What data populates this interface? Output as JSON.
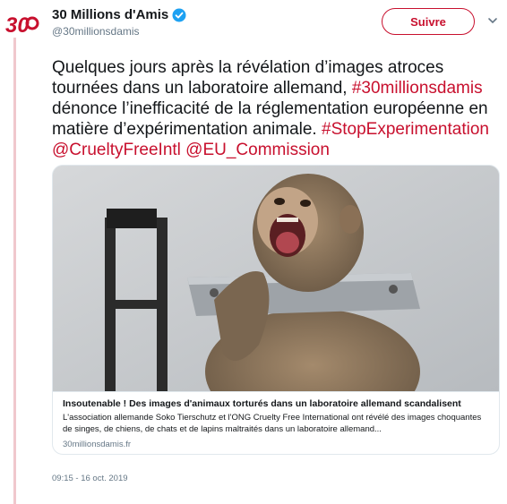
{
  "account": {
    "name": "30 Millions d'Amis",
    "handle": "@30millionsdamis",
    "follow_label": "Suivre"
  },
  "tweet": {
    "text_1": "Quelques jours après la révélation d’images atroces tournées dans un laboratoire allemand, ",
    "tag_1": "#30millionsdamis",
    "text_2": " dénonce l’inefficacité de la réglementation européenne en matière d’expérimentation animale. ",
    "tag_2": "#StopExperimentation",
    "mention_1": "@CrueltyFreeIntl",
    "mention_2": "@EU_Commission"
  },
  "card": {
    "image_icon": "monkey-photo",
    "title": "Insoutenable ! Des images d'animaux torturés dans un laboratoire allemand scandalisent",
    "description": "L'association allemande Soko Tierschutz et l'ONG Cruelty Free International ont révélé des images choquantes de singes, de chiens, de chats et de lapins maltraités dans un laboratoire allemand...",
    "domain": "30millionsdamis.fr"
  },
  "timestamp": "09:15 - 16 oct. 2019",
  "colors": {
    "brand": "#c8102e",
    "verified": "#1da1f2",
    "muted": "#657786"
  }
}
